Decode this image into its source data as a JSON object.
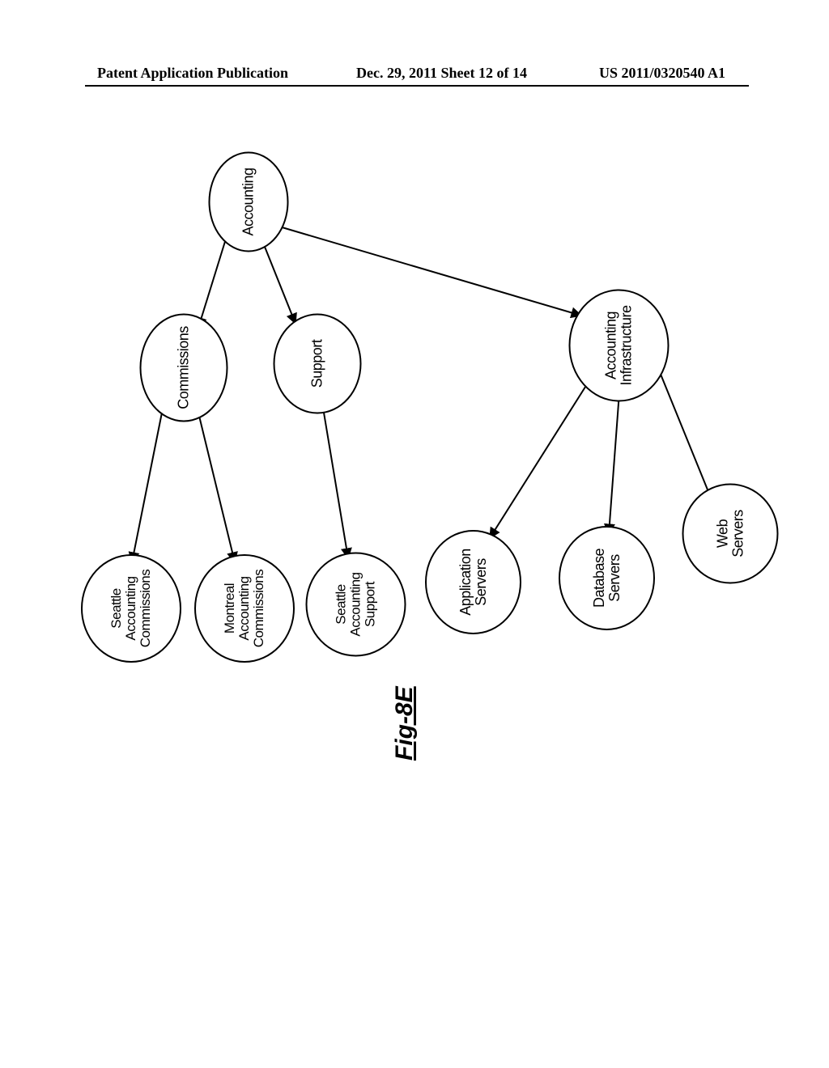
{
  "header": {
    "left": "Patent Application Publication",
    "center": "Dec. 29, 2011  Sheet 12 of 14",
    "right": "US 2011/0320540 A1"
  },
  "figure_label": "Fig-8E",
  "nodes": {
    "accounting": "Accounting",
    "commissions": "Commissions",
    "support": "Support",
    "acct_infra": "Accounting\nInfrastructure",
    "seattle_comm": "Seattle\nAccounting\nCommissions",
    "montreal_comm": "Montreal\nAccounting\nCommissions",
    "seattle_support": "Seattle\nAccounting\nSupport",
    "app_servers": "Application\nServers",
    "db_servers": "Database\nServers",
    "web_servers": "Web\nServers"
  }
}
